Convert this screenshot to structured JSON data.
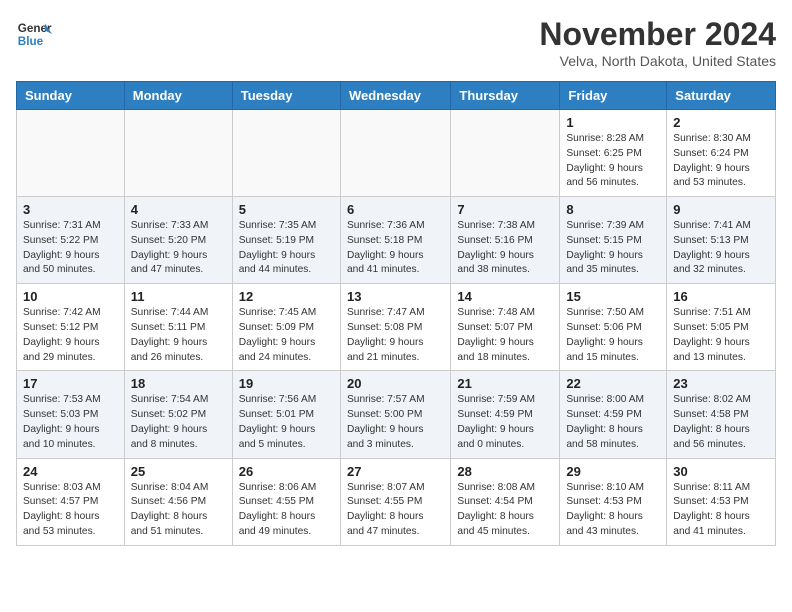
{
  "header": {
    "logo_line1": "General",
    "logo_line2": "Blue",
    "month": "November 2024",
    "location": "Velva, North Dakota, United States"
  },
  "days_of_week": [
    "Sunday",
    "Monday",
    "Tuesday",
    "Wednesday",
    "Thursday",
    "Friday",
    "Saturday"
  ],
  "weeks": [
    [
      {
        "day": "",
        "info": ""
      },
      {
        "day": "",
        "info": ""
      },
      {
        "day": "",
        "info": ""
      },
      {
        "day": "",
        "info": ""
      },
      {
        "day": "",
        "info": ""
      },
      {
        "day": "1",
        "info": "Sunrise: 8:28 AM\nSunset: 6:25 PM\nDaylight: 9 hours\nand 56 minutes."
      },
      {
        "day": "2",
        "info": "Sunrise: 8:30 AM\nSunset: 6:24 PM\nDaylight: 9 hours\nand 53 minutes."
      }
    ],
    [
      {
        "day": "3",
        "info": "Sunrise: 7:31 AM\nSunset: 5:22 PM\nDaylight: 9 hours\nand 50 minutes."
      },
      {
        "day": "4",
        "info": "Sunrise: 7:33 AM\nSunset: 5:20 PM\nDaylight: 9 hours\nand 47 minutes."
      },
      {
        "day": "5",
        "info": "Sunrise: 7:35 AM\nSunset: 5:19 PM\nDaylight: 9 hours\nand 44 minutes."
      },
      {
        "day": "6",
        "info": "Sunrise: 7:36 AM\nSunset: 5:18 PM\nDaylight: 9 hours\nand 41 minutes."
      },
      {
        "day": "7",
        "info": "Sunrise: 7:38 AM\nSunset: 5:16 PM\nDaylight: 9 hours\nand 38 minutes."
      },
      {
        "day": "8",
        "info": "Sunrise: 7:39 AM\nSunset: 5:15 PM\nDaylight: 9 hours\nand 35 minutes."
      },
      {
        "day": "9",
        "info": "Sunrise: 7:41 AM\nSunset: 5:13 PM\nDaylight: 9 hours\nand 32 minutes."
      }
    ],
    [
      {
        "day": "10",
        "info": "Sunrise: 7:42 AM\nSunset: 5:12 PM\nDaylight: 9 hours\nand 29 minutes."
      },
      {
        "day": "11",
        "info": "Sunrise: 7:44 AM\nSunset: 5:11 PM\nDaylight: 9 hours\nand 26 minutes."
      },
      {
        "day": "12",
        "info": "Sunrise: 7:45 AM\nSunset: 5:09 PM\nDaylight: 9 hours\nand 24 minutes."
      },
      {
        "day": "13",
        "info": "Sunrise: 7:47 AM\nSunset: 5:08 PM\nDaylight: 9 hours\nand 21 minutes."
      },
      {
        "day": "14",
        "info": "Sunrise: 7:48 AM\nSunset: 5:07 PM\nDaylight: 9 hours\nand 18 minutes."
      },
      {
        "day": "15",
        "info": "Sunrise: 7:50 AM\nSunset: 5:06 PM\nDaylight: 9 hours\nand 15 minutes."
      },
      {
        "day": "16",
        "info": "Sunrise: 7:51 AM\nSunset: 5:05 PM\nDaylight: 9 hours\nand 13 minutes."
      }
    ],
    [
      {
        "day": "17",
        "info": "Sunrise: 7:53 AM\nSunset: 5:03 PM\nDaylight: 9 hours\nand 10 minutes."
      },
      {
        "day": "18",
        "info": "Sunrise: 7:54 AM\nSunset: 5:02 PM\nDaylight: 9 hours\nand 8 minutes."
      },
      {
        "day": "19",
        "info": "Sunrise: 7:56 AM\nSunset: 5:01 PM\nDaylight: 9 hours\nand 5 minutes."
      },
      {
        "day": "20",
        "info": "Sunrise: 7:57 AM\nSunset: 5:00 PM\nDaylight: 9 hours\nand 3 minutes."
      },
      {
        "day": "21",
        "info": "Sunrise: 7:59 AM\nSunset: 4:59 PM\nDaylight: 9 hours\nand 0 minutes."
      },
      {
        "day": "22",
        "info": "Sunrise: 8:00 AM\nSunset: 4:59 PM\nDaylight: 8 hours\nand 58 minutes."
      },
      {
        "day": "23",
        "info": "Sunrise: 8:02 AM\nSunset: 4:58 PM\nDaylight: 8 hours\nand 56 minutes."
      }
    ],
    [
      {
        "day": "24",
        "info": "Sunrise: 8:03 AM\nSunset: 4:57 PM\nDaylight: 8 hours\nand 53 minutes."
      },
      {
        "day": "25",
        "info": "Sunrise: 8:04 AM\nSunset: 4:56 PM\nDaylight: 8 hours\nand 51 minutes."
      },
      {
        "day": "26",
        "info": "Sunrise: 8:06 AM\nSunset: 4:55 PM\nDaylight: 8 hours\nand 49 minutes."
      },
      {
        "day": "27",
        "info": "Sunrise: 8:07 AM\nSunset: 4:55 PM\nDaylight: 8 hours\nand 47 minutes."
      },
      {
        "day": "28",
        "info": "Sunrise: 8:08 AM\nSunset: 4:54 PM\nDaylight: 8 hours\nand 45 minutes."
      },
      {
        "day": "29",
        "info": "Sunrise: 8:10 AM\nSunset: 4:53 PM\nDaylight: 8 hours\nand 43 minutes."
      },
      {
        "day": "30",
        "info": "Sunrise: 8:11 AM\nSunset: 4:53 PM\nDaylight: 8 hours\nand 41 minutes."
      }
    ]
  ]
}
